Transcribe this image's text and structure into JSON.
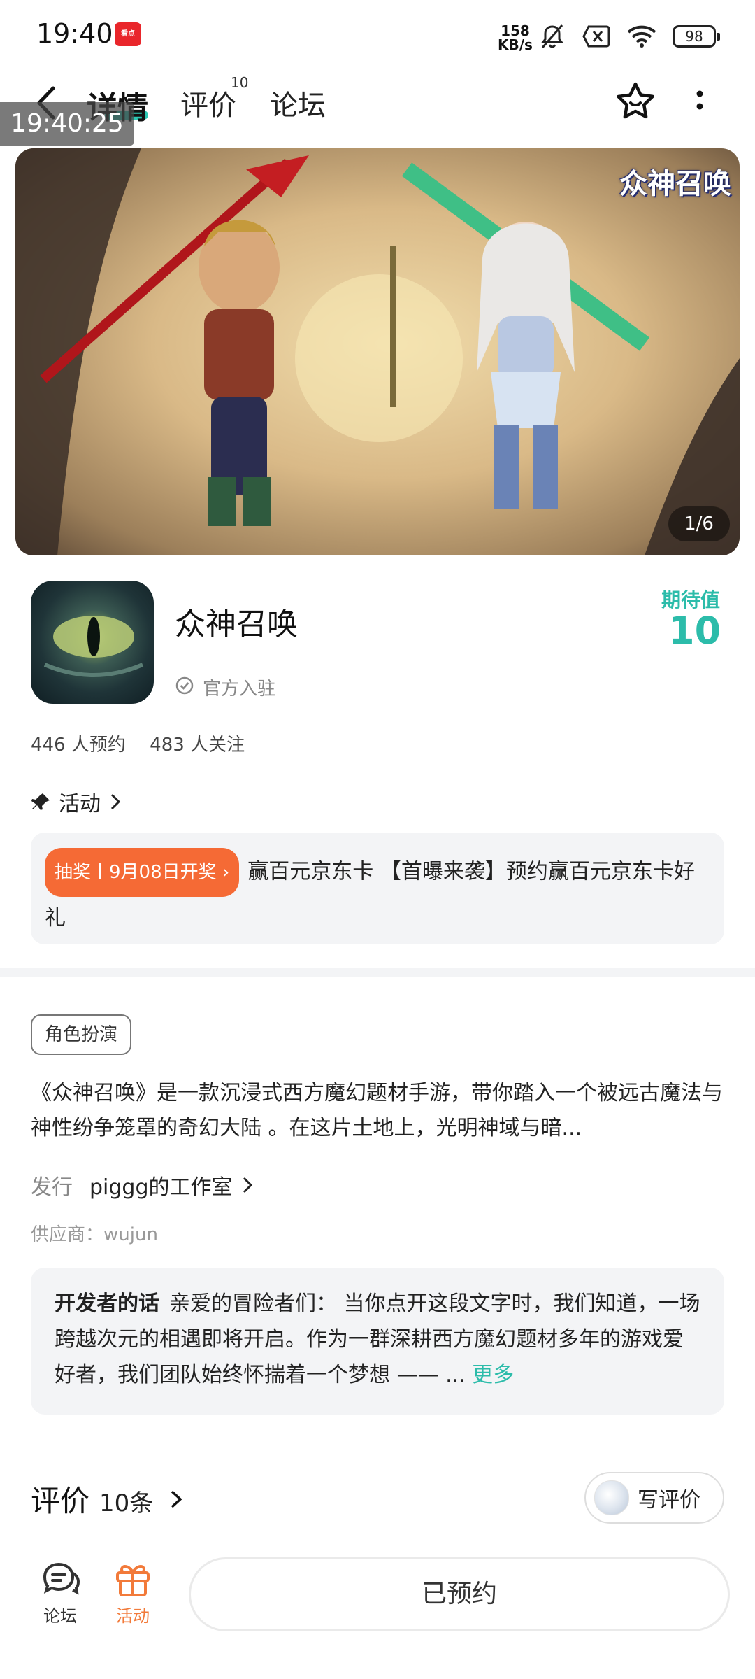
{
  "status_bar": {
    "time": "19:40",
    "app_icon_text": "看点",
    "net_speed_value": "158",
    "net_speed_unit": "KB/s",
    "battery": "98"
  },
  "header": {
    "tabs": [
      {
        "label": "详情",
        "active": true
      },
      {
        "label": "评价",
        "badge": "10"
      },
      {
        "label": "论坛"
      }
    ]
  },
  "overlay_timestamp": "19:40:25",
  "banner": {
    "logo_text": "众神召唤",
    "counter": "1/6"
  },
  "game": {
    "title": "众神召唤",
    "verified_label": "官方入驻",
    "expect_label": "期待值",
    "expect_value": "10",
    "reservations": "446 人预约",
    "followers": "483 人关注"
  },
  "activity": {
    "heading": "活动",
    "badge": "抽奖丨9月08日开奖",
    "text": "赢百元京东卡 【首曝来袭】预约赢百元京东卡好礼"
  },
  "details": {
    "genre": "角色扮演",
    "description": "《众神召唤》是一款沉浸式西方魔幻题材手游，带你踏入一个被远古魔法与神性纷争笼罩的奇幻大陆 。在这片土地上，光明神域与暗...",
    "publisher_key": "发行",
    "publisher_value": "piggg的工作室",
    "supplier": "供应商：wujun"
  },
  "developer_note": {
    "title": "开发者的话",
    "text": "亲爱的冒险者们： 当你点开这段文字时，我们知道，一场跨越次元的相遇即将开启。作为一群深耕西方魔幻题材多年的游戏爱好者，我们团队始终怀揣着一个梦想 —— ...",
    "more": "更多"
  },
  "reviews": {
    "title": "评价",
    "count": "10条",
    "write_label": "写评价"
  },
  "bottom_bar": {
    "forum_label": "论坛",
    "activity_label": "活动",
    "reserve_label": "已预约"
  },
  "colors": {
    "accent": "#2cbcaa",
    "lottery": "#f56a35",
    "activity_icon": "#f27a3a"
  }
}
